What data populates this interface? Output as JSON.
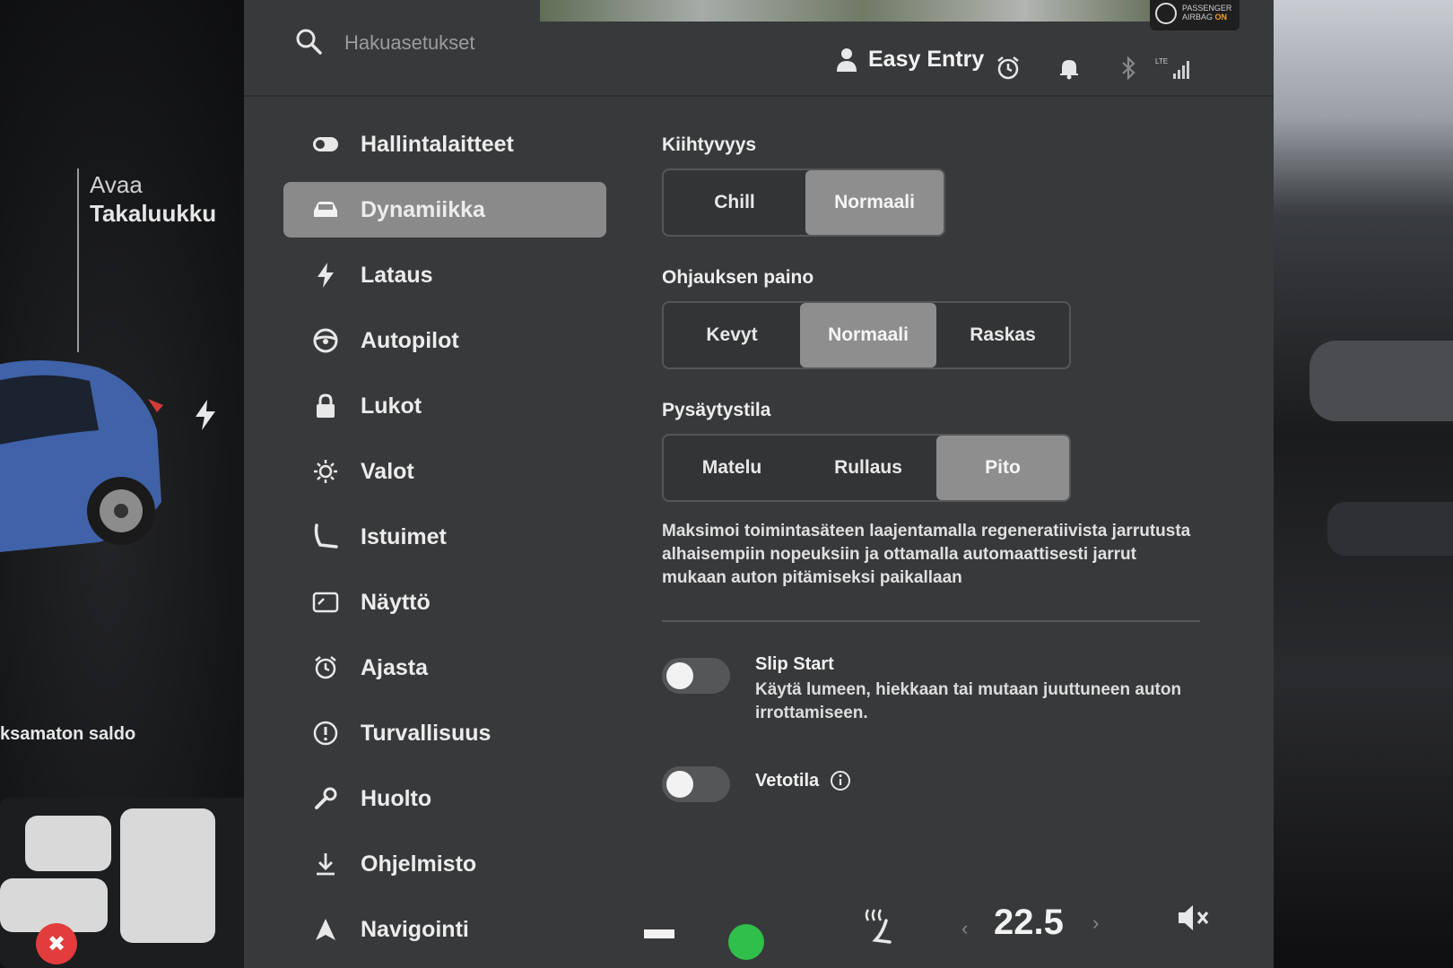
{
  "colors": {
    "screen_bg": "#38393b",
    "active_nav": "#8a8a8b",
    "selected_segment": "#8e8e8f",
    "warning_red": "#e23c3c",
    "status_green": "#2fbf4a"
  },
  "left_pane": {
    "trunk_line1": "Avaa",
    "trunk_line2": "Takaluukku",
    "balance_text": "ksamaton saldo",
    "car_color": "#3f62a8"
  },
  "topbar": {
    "search_placeholder": "Hakuasetukset",
    "profile_name": "Easy Entry",
    "icons": [
      "search-icon",
      "person-icon",
      "alarm-icon",
      "bell-icon",
      "bluetooth-icon",
      "lte-signal-icon"
    ],
    "airbag_line1": "PASSENGER",
    "airbag_line2": "AIRBAG",
    "airbag_state": "ON"
  },
  "sidebar": {
    "items": [
      {
        "label": "Hallintalaitteet",
        "icon": "toggle-icon",
        "active": false
      },
      {
        "label": "Dynamiikka",
        "icon": "car-icon",
        "active": true
      },
      {
        "label": "Lataus",
        "icon": "bolt-icon",
        "active": false
      },
      {
        "label": "Autopilot",
        "icon": "steering-wheel-icon",
        "active": false
      },
      {
        "label": "Lukot",
        "icon": "lock-icon",
        "active": false
      },
      {
        "label": "Valot",
        "icon": "sun-icon",
        "active": false
      },
      {
        "label": "Istuimet",
        "icon": "seat-icon",
        "active": false
      },
      {
        "label": "Näyttö",
        "icon": "display-icon",
        "active": false
      },
      {
        "label": "Ajasta",
        "icon": "alarm-icon",
        "active": false
      },
      {
        "label": "Turvallisuus",
        "icon": "alert-circle-icon",
        "active": false
      },
      {
        "label": "Huolto",
        "icon": "wrench-icon",
        "active": false
      },
      {
        "label": "Ohjelmisto",
        "icon": "download-icon",
        "active": false
      },
      {
        "label": "Navigointi",
        "icon": "navigation-arrow-icon",
        "active": false
      }
    ]
  },
  "content": {
    "acceleration": {
      "title": "Kiihtyvyys",
      "options": [
        "Chill",
        "Normaali"
      ],
      "selected": 1
    },
    "steering": {
      "title": "Ohjauksen paino",
      "options": [
        "Kevyt",
        "Normaali",
        "Raskas"
      ],
      "selected": 1
    },
    "stopping": {
      "title": "Pysäytystila",
      "options": [
        "Matelu",
        "Rullaus",
        "Pito"
      ],
      "selected": 2,
      "description": "Maksimoi toimintasäteen laajentamalla regeneratiivista jarrutusta alhaisempiin nopeuksiin ja ottamalla automaattisesti jarrut mukaan auton pitämiseksi paikallaan"
    },
    "slip_start": {
      "title": "Slip Start",
      "description": "Käytä lumeen, hiekkaan tai mutaan juuttuneen auton irrottamiseen.",
      "enabled": false
    },
    "traction": {
      "title": "Vetotila",
      "enabled": false
    }
  },
  "bottombar": {
    "temperature": "22.5",
    "temp_decrease": "‹",
    "temp_increase": "›",
    "icons": [
      "seat-heat-icon",
      "volume-mute-icon"
    ]
  }
}
